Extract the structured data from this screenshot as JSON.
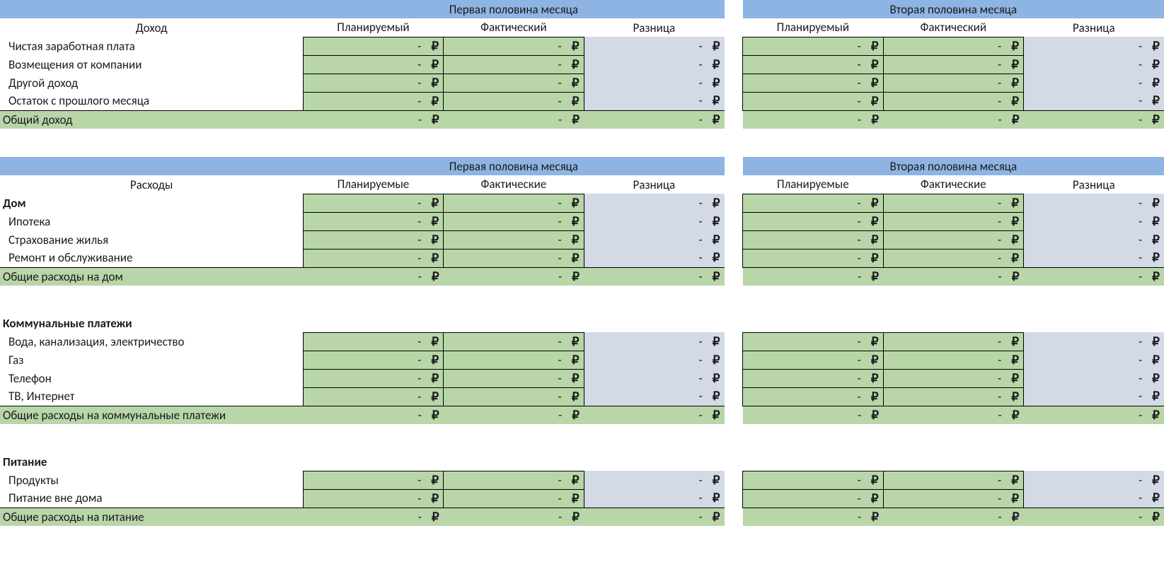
{
  "currency": "₽",
  "dash": "-",
  "headers": {
    "first_half": "Первая половина месяца",
    "second_half": "Вторая половина месяца",
    "planned_m": "Планируемый",
    "actual_m": "Фактический",
    "planned_p": "Планируемые",
    "actual_p": "Фактические",
    "diff": "Разница"
  },
  "income": {
    "title": "Доход",
    "rows": [
      "Чистая заработная плата",
      "Возмещения от компании",
      "Другой доход",
      "Остаток с прошлого месяца"
    ],
    "total": "Общий доход"
  },
  "expenses": {
    "title": "Расходы",
    "sections": [
      {
        "name": "Дом",
        "name_has_values": true,
        "rows": [
          "Ипотека",
          "Страхование жилья",
          "Ремонт и обслуживание"
        ],
        "total": "Общие расходы на дом"
      },
      {
        "name": "Коммунальные платежи",
        "name_has_values": false,
        "rows": [
          "Вода, канализация, электричество",
          "Газ",
          "Телефон",
          "ТВ, Интернет"
        ],
        "total": "Общие расходы на коммунальные платежи"
      },
      {
        "name": "Питание",
        "name_has_values": false,
        "rows": [
          "Продукты",
          "Питание вне дома"
        ],
        "total": "Общие расходы на питание"
      }
    ]
  }
}
